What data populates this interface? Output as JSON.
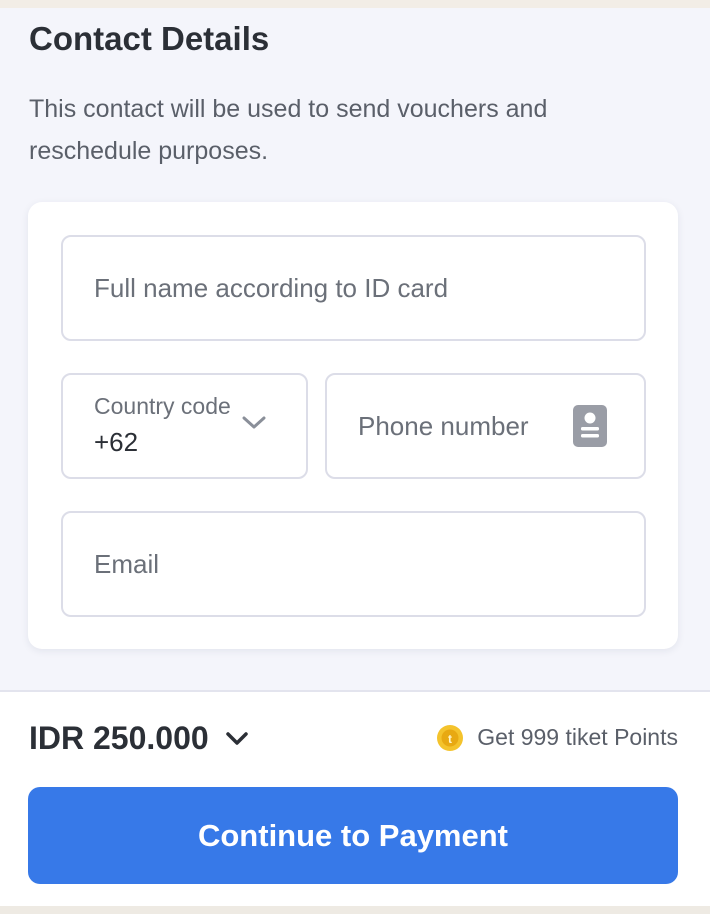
{
  "contact": {
    "title": "Contact Details",
    "description": "This contact will be used to send vouchers and reschedule purposes."
  },
  "form": {
    "full_name": {
      "value": "",
      "placeholder": "Full name according to ID card"
    },
    "country_code": {
      "label": "Country code",
      "value": "+62",
      "icon": "chevron-down-icon"
    },
    "phone": {
      "value": "",
      "placeholder": "Phone number",
      "icon": "contact-book-icon"
    },
    "email": {
      "value": "",
      "placeholder": "Email"
    }
  },
  "footer": {
    "price": "IDR 250.000",
    "points_text": "Get 999 tiket Points",
    "coin_icon": "tiket-coin-icon",
    "cta_label": "Continue to Payment"
  },
  "colors": {
    "accent": "#3779e8",
    "coin": "#f4c32c",
    "background": "#f4f5fb"
  }
}
